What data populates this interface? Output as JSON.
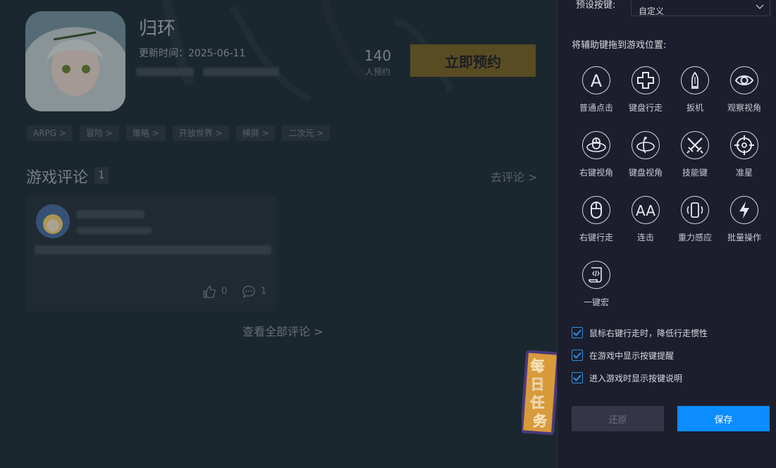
{
  "game": {
    "title": "归环",
    "update_label": "更新时间：",
    "update_date": "2025-06-11",
    "reserve_count": "140",
    "reserve_label": "人预约",
    "reserve_button": "立即预约",
    "tags": [
      "ARPG >",
      "冒险 >",
      "策略 >",
      "开放世界 >",
      "横屏 >",
      "二次元 >"
    ]
  },
  "reviews": {
    "title": "游戏评论",
    "count": "1",
    "go_review": "去评论 >",
    "card": {
      "likes": "0",
      "comments": "1"
    },
    "view_all": "查看全部评论 >"
  },
  "daily_task": {
    "text": "每日任务",
    "color": "#f2a33a"
  },
  "panel": {
    "preset_label": "预设按键:",
    "preset_value": "自定义",
    "drag_hint": "将辅助键拖到游戏位置:",
    "keys": [
      {
        "label": "普通点击",
        "icon": "letter-a-icon"
      },
      {
        "label": "键盘行走",
        "icon": "dpad-icon"
      },
      {
        "label": "扳机",
        "icon": "bullet-icon"
      },
      {
        "label": "观察视角",
        "icon": "eye-icon"
      },
      {
        "label": "右键视角",
        "icon": "mouse-orbit-icon"
      },
      {
        "label": "键盘视角",
        "icon": "keyboard-orbit-icon"
      },
      {
        "label": "技能键",
        "icon": "crossed-swords-icon"
      },
      {
        "label": "准星",
        "icon": "crosshair-icon"
      },
      {
        "label": "右键行走",
        "icon": "mouse-icon"
      },
      {
        "label": "连击",
        "icon": "double-a-icon"
      },
      {
        "label": "重力感应",
        "icon": "phone-rotate-icon"
      },
      {
        "label": "批量操作",
        "icon": "lightning-icon"
      },
      {
        "label": "一键宏",
        "icon": "script-icon"
      }
    ],
    "checkboxes": [
      {
        "label": "鼠标右键行走时，降低行走惯性",
        "checked": true
      },
      {
        "label": "在游戏中显示按键提醒",
        "checked": true
      },
      {
        "label": "进入游戏时显示按键说明",
        "checked": true
      }
    ],
    "restore_button": "还原",
    "save_button": "保存",
    "accent_color": "#0b8cff"
  }
}
